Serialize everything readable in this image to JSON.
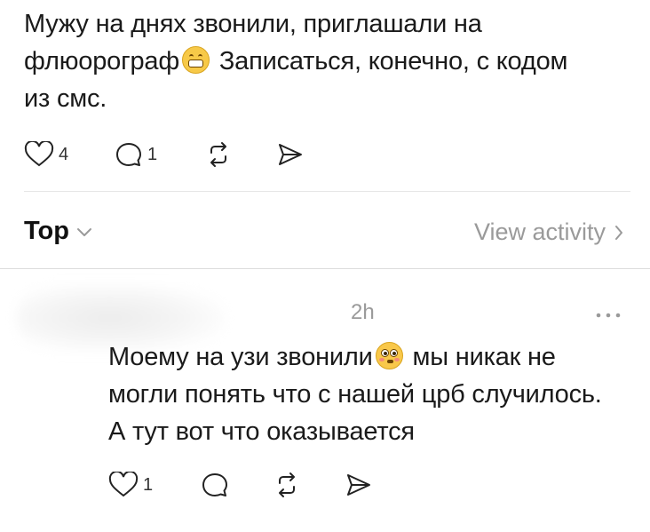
{
  "post": {
    "text_part1": "Мужу на днях звонили, приглашали на флюорограф",
    "emoji_1": "grinning-face-icon",
    "text_part2": "Записаться, конечно, с кодом из смс.",
    "likes": "4",
    "replies": "1"
  },
  "sort": {
    "label": "Top"
  },
  "activity": {
    "label": "View activity"
  },
  "reply": {
    "time": "2h",
    "text_part1": "Моему на узи звонили",
    "emoji_1": "flushed-face-icon",
    "text_part2": "мы никак не могли понять что с нашей црб случилось. А тут вот что оказывается",
    "likes": "1"
  },
  "icons": {
    "like": "heart-icon",
    "reply": "comment-icon",
    "repost": "repost-icon",
    "share": "send-icon",
    "more": "more-icon"
  },
  "colors": {
    "text": "#1a1a1a",
    "muted": "#9a9a9a",
    "divider": "#dcdcdc"
  }
}
